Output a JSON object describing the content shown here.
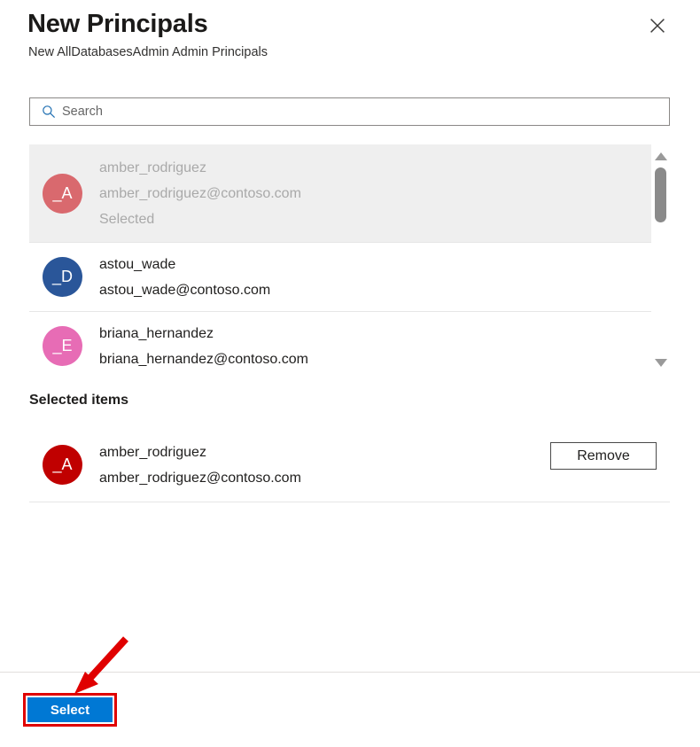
{
  "panel": {
    "title": "New Principals",
    "subtitle": "New AllDatabasesAdmin Admin Principals",
    "close_icon": "close-icon"
  },
  "search": {
    "icon": "search-icon",
    "placeholder": "Search",
    "value": ""
  },
  "results": {
    "rows": [
      {
        "initials": "_A",
        "avatar_color": "#d9696e",
        "name": "amber_rodriguez",
        "email": "amber_rodriguez@contoso.com",
        "status": "Selected",
        "disabled": true
      },
      {
        "initials": "_D",
        "avatar_color": "#2a5699",
        "name": "astou_wade",
        "email": "astou_wade@contoso.com",
        "status": "",
        "disabled": false
      },
      {
        "initials": "_E",
        "avatar_color": "#e76cb5",
        "name": "briana_hernandez",
        "email": "briana_hernandez@contoso.com",
        "status": "",
        "disabled": false
      }
    ],
    "scrollbar": {
      "up_icon": "scroll-up-arrow-icon",
      "down_icon": "scroll-down-arrow-icon"
    }
  },
  "selected_items": {
    "heading": "Selected items",
    "items": [
      {
        "initials": "_A",
        "avatar_color": "#c00000",
        "name": "amber_rodriguez",
        "email": "amber_rodriguez@contoso.com",
        "remove_label": "Remove"
      }
    ]
  },
  "footer": {
    "select_label": "Select"
  },
  "annotation": {
    "color": "#e00000"
  }
}
